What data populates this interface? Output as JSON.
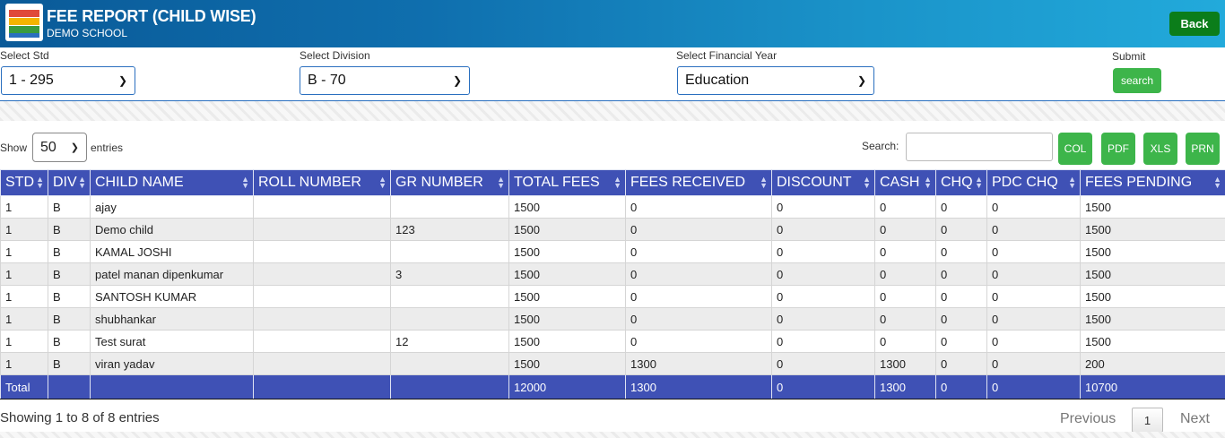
{
  "header": {
    "title": "FEE REPORT (CHILD WISE)",
    "subtitle": "DEMO SCHOOL",
    "back_label": "Back"
  },
  "filters": {
    "std_label": "Select Std",
    "std_value": "1 - 295",
    "division_label": "Select Division",
    "division_value": "B - 70",
    "year_label": "Select Financial Year",
    "year_value": "Education",
    "submit_label": "Submit",
    "search_button": "search"
  },
  "table_controls": {
    "show_label": "Show",
    "entries_value": "50",
    "entries_label": "entries",
    "search_label": "Search:",
    "search_value": "",
    "export_buttons": [
      "COL",
      "PDF",
      "XLS",
      "PRN"
    ]
  },
  "table": {
    "columns": [
      "STD",
      "DIV",
      "CHILD NAME",
      "ROLL NUMBER",
      "GR NUMBER",
      "TOTAL FEES",
      "FEES RECEIVED",
      "DISCOUNT",
      "CASH",
      "CHQ",
      "PDC CHQ",
      "FEES PENDING"
    ],
    "rows": [
      [
        "1",
        "B",
        "ajay",
        "",
        "",
        "1500",
        "0",
        "0",
        "0",
        "0",
        "0",
        "1500"
      ],
      [
        "1",
        "B",
        "Demo child",
        "",
        "123",
        "1500",
        "0",
        "0",
        "0",
        "0",
        "0",
        "1500"
      ],
      [
        "1",
        "B",
        "KAMAL JOSHI",
        "",
        "",
        "1500",
        "0",
        "0",
        "0",
        "0",
        "0",
        "1500"
      ],
      [
        "1",
        "B",
        "patel manan dipenkumar",
        "",
        "3",
        "1500",
        "0",
        "0",
        "0",
        "0",
        "0",
        "1500"
      ],
      [
        "1",
        "B",
        "SANTOSH KUMAR",
        "",
        "",
        "1500",
        "0",
        "0",
        "0",
        "0",
        "0",
        "1500"
      ],
      [
        "1",
        "B",
        "shubhankar",
        "",
        "",
        "1500",
        "0",
        "0",
        "0",
        "0",
        "0",
        "1500"
      ],
      [
        "1",
        "B",
        "Test surat",
        "",
        "12",
        "1500",
        "0",
        "0",
        "0",
        "0",
        "0",
        "1500"
      ],
      [
        "1",
        "B",
        "viran yadav",
        "",
        "",
        "1500",
        "1300",
        "0",
        "1300",
        "0",
        "0",
        "200"
      ]
    ],
    "footer": [
      "Total",
      "",
      "",
      "",
      "",
      "12000",
      "1300",
      "0",
      "1300",
      "0",
      "0",
      "10700"
    ]
  },
  "pagination": {
    "info": "Showing 1 to 8 of 8 entries",
    "previous": "Previous",
    "current_page": "1",
    "next": "Next"
  },
  "colors": {
    "header_gradient_start": "#0a5a98",
    "header_gradient_end": "#22aadb",
    "table_header": "#3f51b5",
    "button_green": "#3db54a",
    "back_green": "#0b7d1a"
  }
}
